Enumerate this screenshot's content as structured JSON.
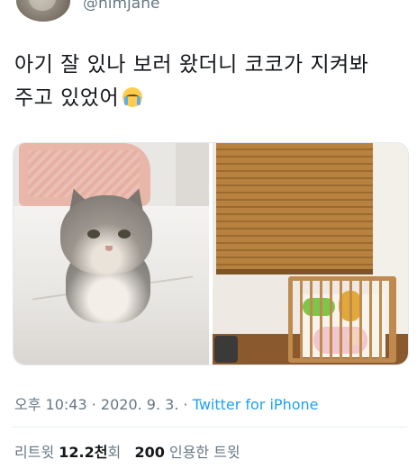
{
  "user": {
    "handle": "@nimjane"
  },
  "tweet": {
    "text_line1": "아기 잘 있나 보러 왔더니 코코가 지켜봐",
    "text_line2": "주고 있었어",
    "emoji_name": "loudly-crying-face-emoji"
  },
  "meta": {
    "time": "오후 10:43",
    "separator1": " · ",
    "date": "2020. 9. 3.",
    "separator2": " · ",
    "source": "Twitter for iPhone"
  },
  "stats": {
    "retweet_label": "리트윗",
    "retweet_count": "12.2천",
    "retweet_suffix": "회",
    "quote_count": "200",
    "quote_label": "인용한 트윗"
  },
  "colors": {
    "accent": "#1da1f2",
    "secondary_text": "#657786",
    "primary_text": "#14171a"
  }
}
